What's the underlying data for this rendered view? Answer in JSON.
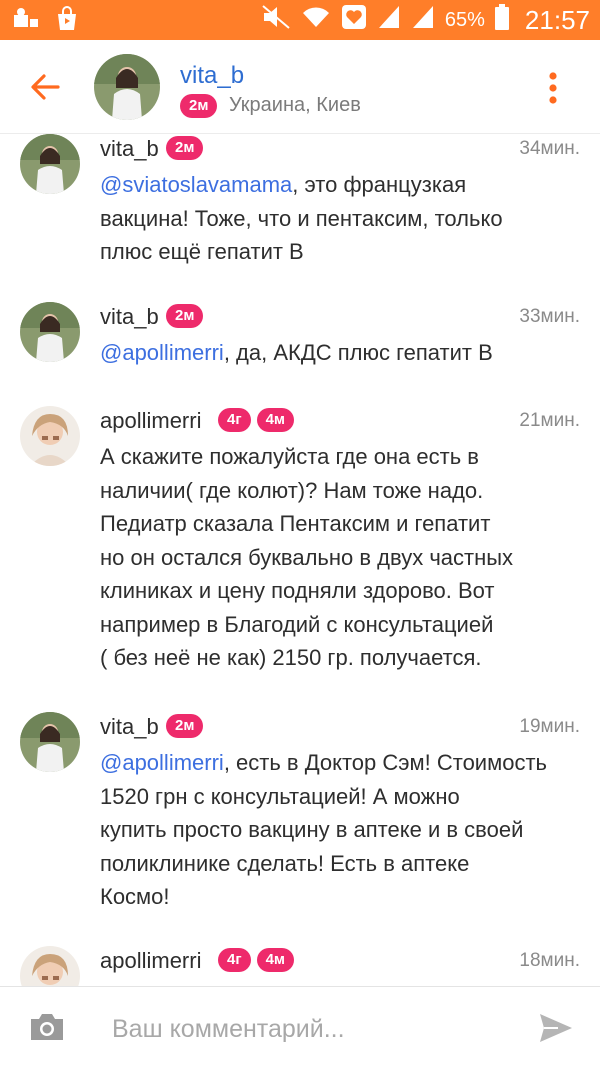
{
  "status_bar": {
    "battery_percent": "65%",
    "time": "21:57",
    "icons": [
      "notification-icon",
      "shop-icon",
      "mute-icon",
      "wifi-icon",
      "heart-icon",
      "signal-icon",
      "signal-icon",
      "battery-icon"
    ]
  },
  "header": {
    "name": "vita_b",
    "badge": "2м",
    "location": "Украина, Киев"
  },
  "comments": [
    {
      "name": "vita_b",
      "badges": [
        "2м"
      ],
      "time": "34мин.",
      "mention": "@sviatoslavamama",
      "text": ", это французкая\nвакцина! Тоже, что и пентаксим, только\nплюс ещё гепатит В"
    },
    {
      "name": "vita_b",
      "badges": [
        "2м"
      ],
      "time": "33мин.",
      "mention": "@apollimerri",
      "text": ", да, АКДС плюс гепатит В"
    },
    {
      "name": "apollimerri",
      "badges": [
        "4г",
        "4м"
      ],
      "time": "21мин.",
      "mention": "",
      "text": "А скажите пожалуйста где она есть в\nналичии( где колют)? Нам тоже надо.\nПедиатр сказала Пентаксим и  гепатит\nно он остался буквально в двух частных\nклиниках и цену подняли здорово. Вот\nнапример в Благодий с консультацией\n( без неё не как) 2150 гр. получается."
    },
    {
      "name": "vita_b",
      "badges": [
        "2м"
      ],
      "time": "19мин.",
      "mention": "@apollimerri",
      "text": ", есть в Доктор Сэм! Стоимость\n1520 грн с консультацией! А можно\nкупить просто вакцину в аптеке и в своей\nполиклинике сделать! Есть в аптеке\nКосмо!"
    },
    {
      "name": "apollimerri",
      "badges": [
        "4г",
        "4м"
      ],
      "time": "18мин.",
      "mention": "",
      "text": ""
    }
  ],
  "composer": {
    "placeholder": "Ваш комментарий..."
  },
  "colors": {
    "status_bar": "#ff7e29",
    "accent": "#ff6a1f",
    "badge": "#ee2a6b",
    "mention": "#3d6fe0",
    "header_name": "#2e6dd1"
  }
}
